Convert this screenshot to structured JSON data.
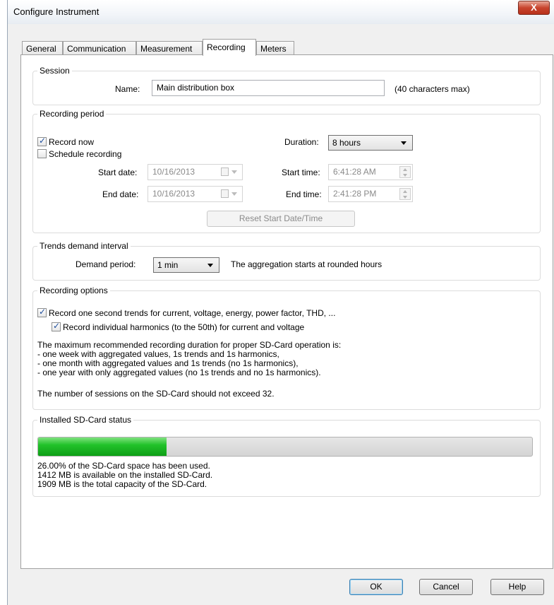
{
  "window": {
    "title": "Configure Instrument",
    "close_glyph": "X"
  },
  "tabs": [
    {
      "label": "General"
    },
    {
      "label": "Communication"
    },
    {
      "label": "Measurement"
    },
    {
      "label": "Recording"
    },
    {
      "label": "Meters"
    }
  ],
  "active_tab": "Recording",
  "session": {
    "legend": "Session",
    "name_label": "Name:",
    "name_value": "Main distribution box",
    "hint": "(40 characters max)"
  },
  "recording_period": {
    "legend": "Recording period",
    "record_now_label": "Record now",
    "record_now_checked": true,
    "schedule_label": "Schedule recording",
    "schedule_checked": false,
    "duration_label": "Duration:",
    "duration_value": "8 hours",
    "start_date_label": "Start date:",
    "start_date_value": "10/16/2013",
    "end_date_label": "End date:",
    "end_date_value": "10/16/2013",
    "start_time_label": "Start time:",
    "start_time_value": "6:41:28 AM",
    "end_time_label": "End time:",
    "end_time_value": "2:41:28 PM",
    "reset_label": "Reset Start Date/Time"
  },
  "trends": {
    "legend": "Trends demand interval",
    "demand_label": "Demand period:",
    "demand_value": "1 min",
    "note": "The aggregation starts at rounded hours"
  },
  "recording_options": {
    "legend": "Recording options",
    "opt1_label": "Record one second trends for current, voltage, energy, power factor, THD, ...",
    "opt1_checked": true,
    "opt2_label": "Record individual harmonics (to the 50th) for current and voltage",
    "opt2_checked": true,
    "info_lines": [
      "The maximum recommended recording duration for proper SD-Card operation is:",
      "- one week with aggregated values, 1s trends and 1s harmonics,",
      "- one month with aggregated values and 1s trends (no 1s harmonics),",
      "- one year with only aggregated values (no 1s trends and no 1s harmonics)."
    ],
    "sessions_note": "The number of sessions on the SD-Card should not exceed 32."
  },
  "sd_card": {
    "legend": "Installed SD-Card status",
    "used_fraction": 0.26,
    "lines": [
      "26.00% of the SD-Card space has been used.",
      "1412 MB is available on the installed SD-Card.",
      "1909 MB is the total capacity of the SD-Card."
    ]
  },
  "buttons": {
    "ok": "OK",
    "cancel": "Cancel",
    "help": "Help"
  },
  "colors": {
    "progress_fill": "#22c22a",
    "close_button": "#c8442e",
    "check_mark": "#1e4e9c"
  }
}
